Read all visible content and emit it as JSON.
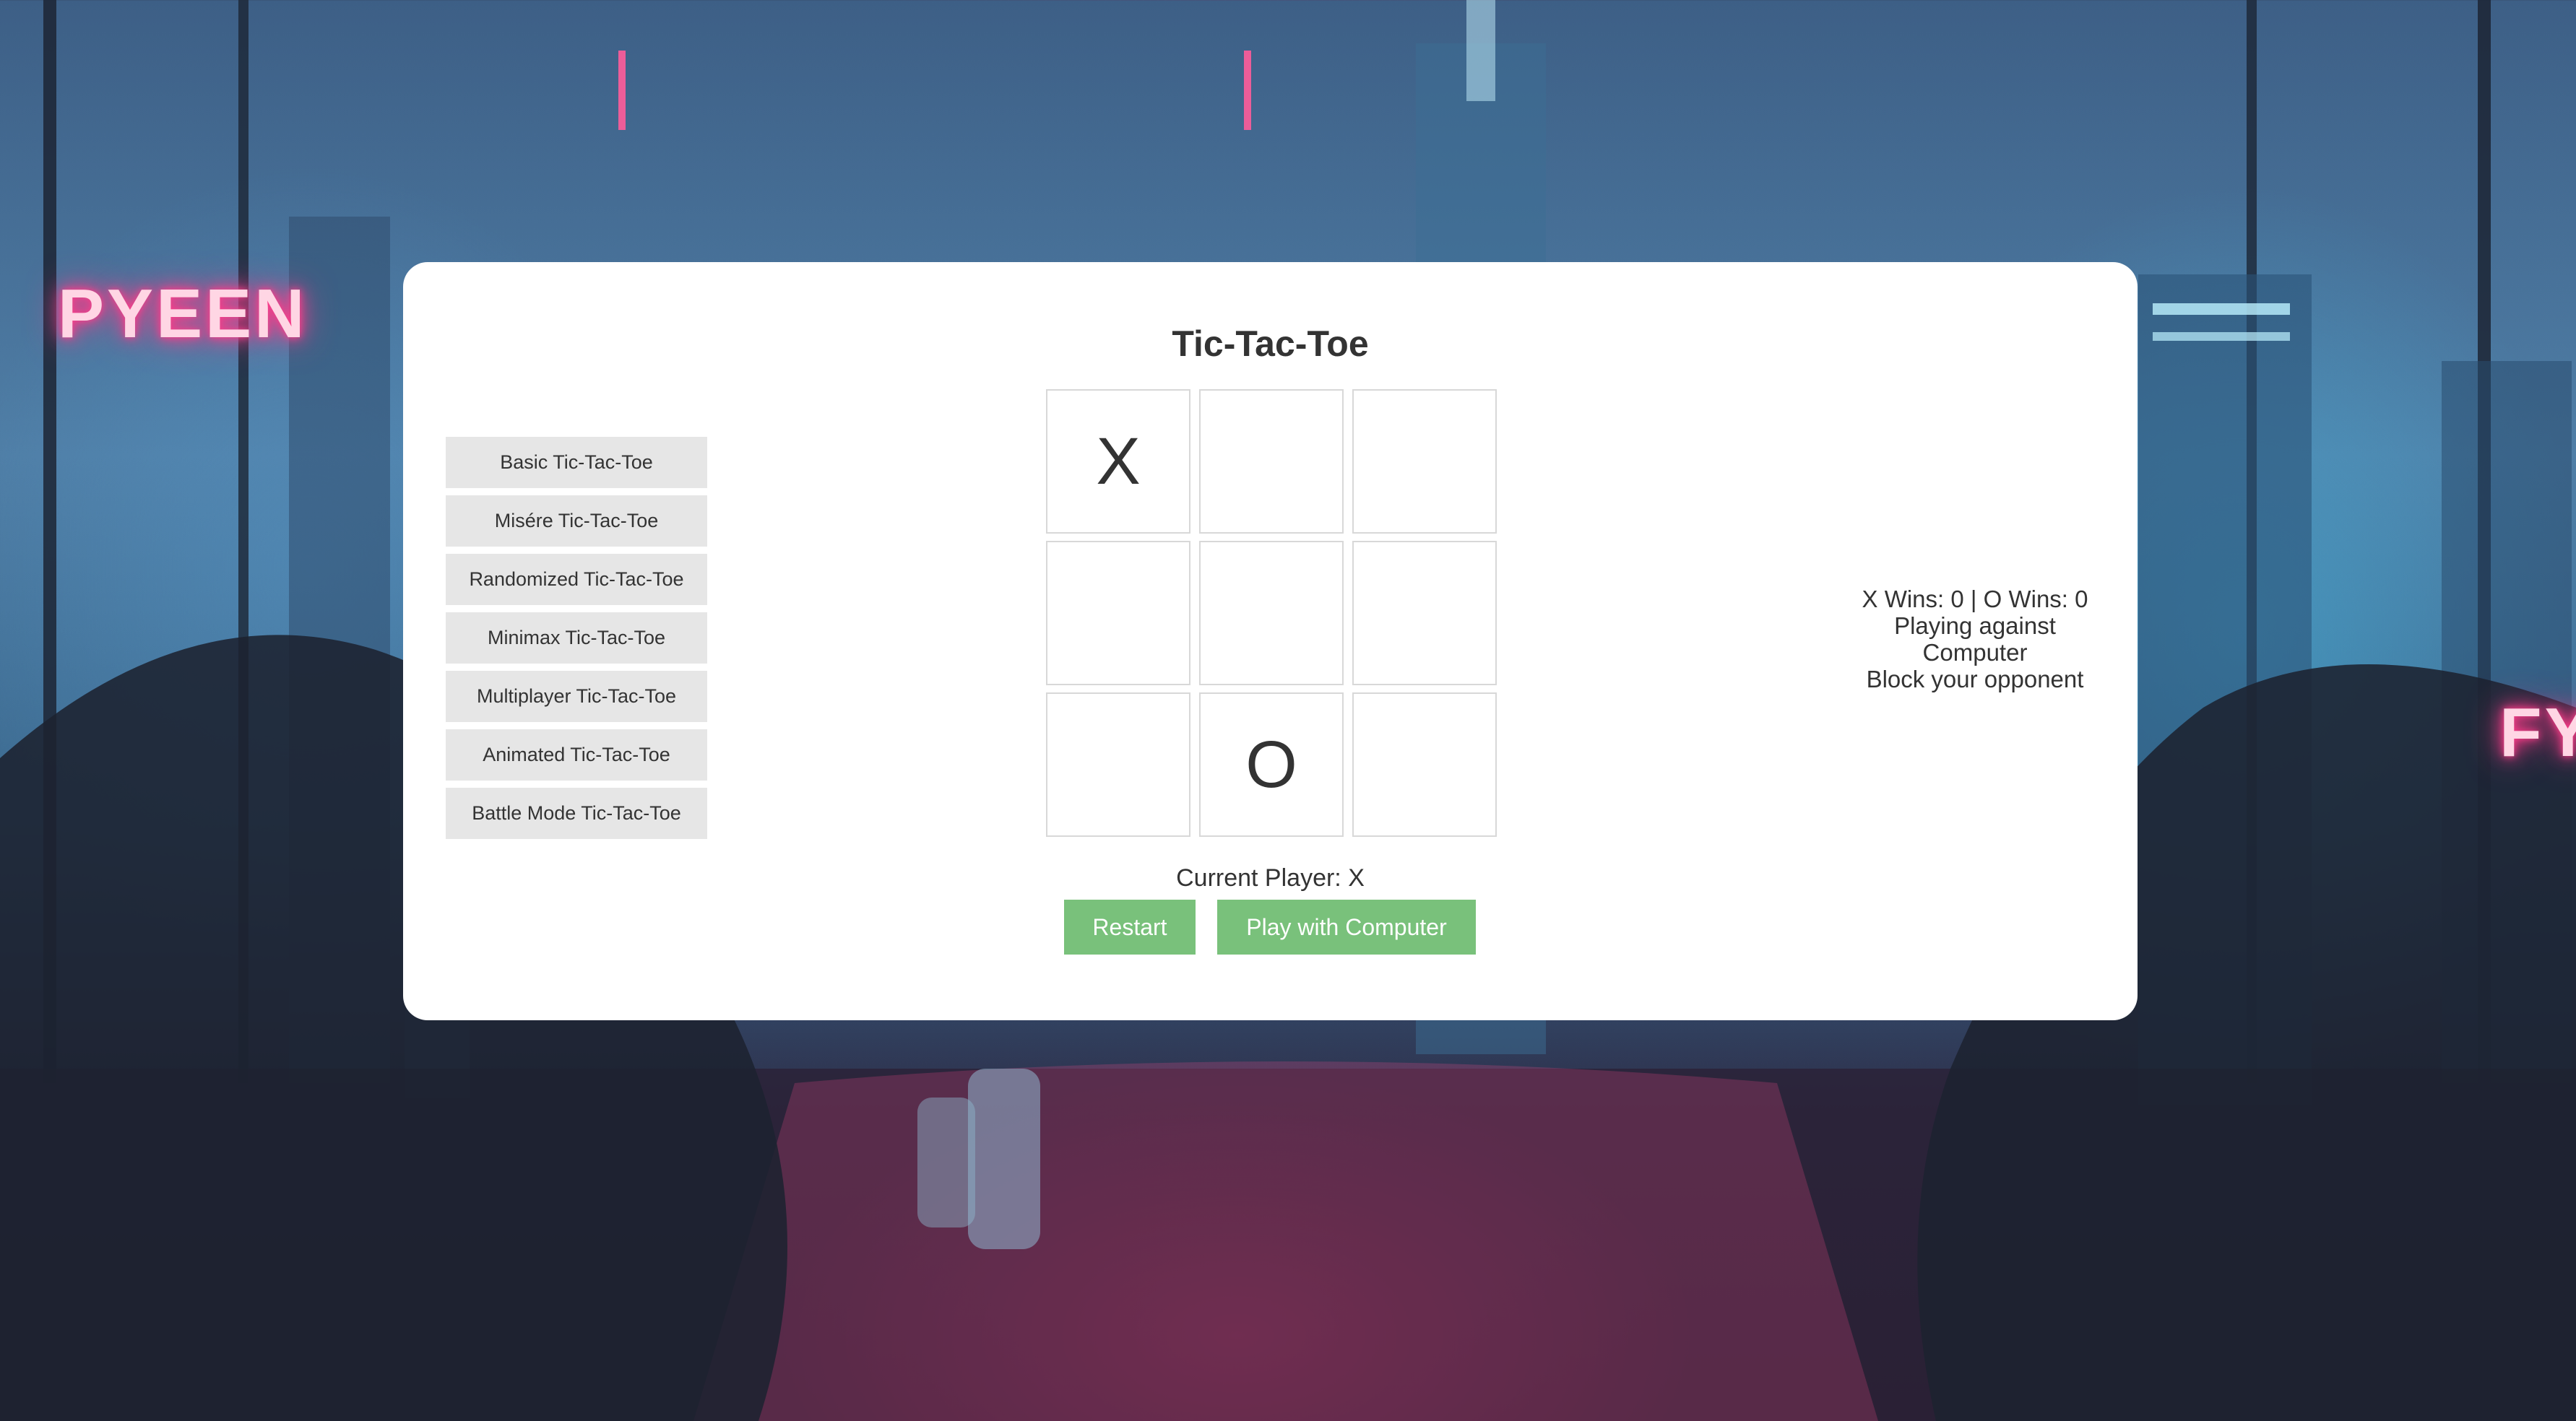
{
  "app": {
    "title": "Tic-Tac-Toe"
  },
  "variants": [
    {
      "label": "Basic Tic-Tac-Toe"
    },
    {
      "label": "Misére Tic-Tac-Toe"
    },
    {
      "label": "Randomized Tic-Tac-Toe"
    },
    {
      "label": "Minimax Tic-Tac-Toe"
    },
    {
      "label": "Multiplayer Tic-Tac-Toe"
    },
    {
      "label": "Animated Tic-Tac-Toe"
    },
    {
      "label": "Battle Mode Tic-Tac-Toe"
    }
  ],
  "board": {
    "cells": [
      "X",
      "",
      "",
      "",
      "",
      "",
      "",
      "O",
      ""
    ]
  },
  "game": {
    "current_player": "Current Player: X"
  },
  "controls": {
    "restart_label": "Restart",
    "play_computer_label": "Play with Computer"
  },
  "status": {
    "score": "X Wins: 0 | O Wins: 0",
    "mode_line1": "Playing against",
    "mode_line2": "Computer",
    "hint": "Block your opponent"
  },
  "colors": {
    "panel_background": "#ffffff",
    "button_green": "#79c17b",
    "variant_button_gray": "#e6e6e6",
    "text_dark": "#333333",
    "neon_pink": "#ff3c8a"
  }
}
